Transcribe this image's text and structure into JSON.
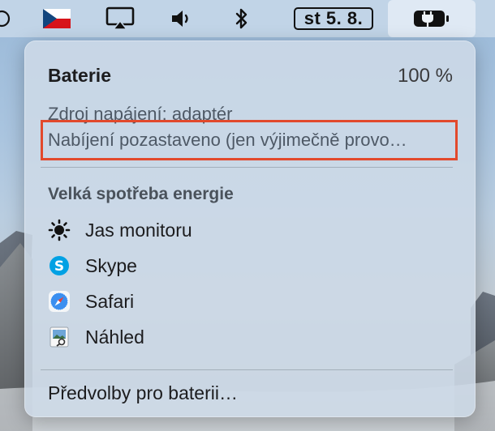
{
  "menu_bar": {
    "flag_icon": "czech-flag-icon",
    "airplay_icon": "airplay-icon",
    "volume_icon": "speaker-icon",
    "bluetooth_icon": "bluetooth-icon",
    "date": "st 5. 8.",
    "battery_icon": "battery-charging-icon"
  },
  "battery_menu": {
    "title": "Baterie",
    "percent": "100 %",
    "power_source": "Zdroj napájení: adaptér",
    "charging_status": "Nabíjení pozastaveno (jen výjimečně provo…",
    "highlight_color": "#e2492c",
    "energy_heading": "Velká spotřeba energie",
    "apps": [
      {
        "name": "Jas monitoru",
        "icon": "brightness-icon"
      },
      {
        "name": "Skype",
        "icon": "skype-icon"
      },
      {
        "name": "Safari",
        "icon": "safari-icon"
      },
      {
        "name": "Náhled",
        "icon": "preview-icon"
      }
    ],
    "preferences": "Předvolby pro baterii…"
  }
}
